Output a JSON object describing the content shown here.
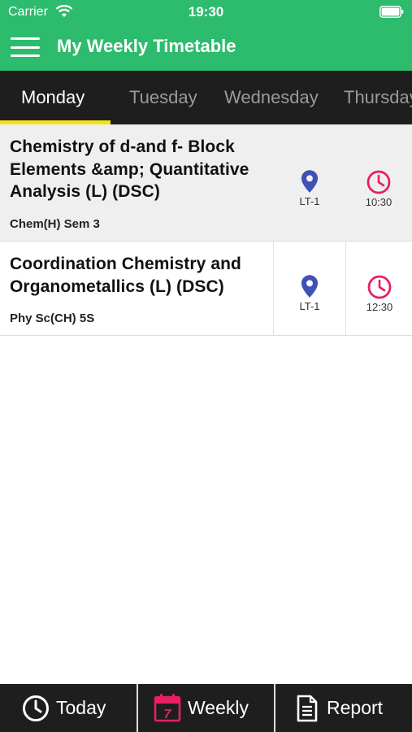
{
  "status_bar": {
    "carrier": "Carrier",
    "time": "19:30"
  },
  "app_bar": {
    "title": "My Weekly Timetable"
  },
  "day_tabs": [
    {
      "label": "Monday",
      "active": true
    },
    {
      "label": "Tuesday",
      "active": false
    },
    {
      "label": "Wednesday",
      "active": false
    },
    {
      "label": "Thursday",
      "active": false
    }
  ],
  "classes": [
    {
      "subject": "Chemistry of d-and f- Block Elements &amp; Quantitative Analysis (L) (DSC)",
      "section": "Chem(H) Sem 3",
      "room": "LT-1",
      "time": "10:30"
    },
    {
      "subject": "Coordination Chemistry and Organometallics (L) (DSC)",
      "section": "Phy Sc(CH) 5S",
      "room": "LT-1",
      "time": "12:30"
    }
  ],
  "bottom_tabs": [
    {
      "label": "Today",
      "icon": "clock-icon"
    },
    {
      "label": "Weekly",
      "icon": "calendar-icon",
      "calendar_day": "7"
    },
    {
      "label": "Report",
      "icon": "document-icon"
    }
  ],
  "colors": {
    "header": "#2dbb6d",
    "tab_bg": "#1e1e1e",
    "indicator": "#f5e21a",
    "location": "#3f51b5",
    "clock": "#e91e63",
    "calendar": "#e91e63"
  }
}
